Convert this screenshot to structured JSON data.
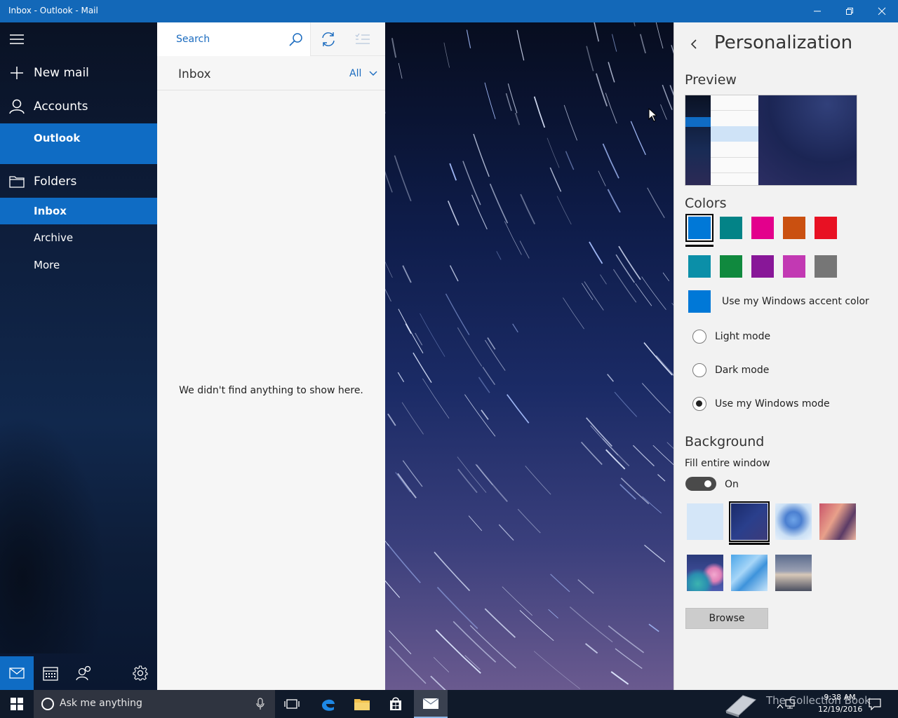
{
  "window": {
    "title": "Inbox - Outlook - Mail"
  },
  "nav": {
    "new_mail": "New mail",
    "accounts": "Accounts",
    "account_name": "Outlook",
    "folders": "Folders",
    "folder_items": [
      "Inbox",
      "Archive",
      "More"
    ]
  },
  "list": {
    "search_placeholder": "Search",
    "header": "Inbox",
    "filter": "All",
    "empty_message": "We didn't find anything to show here."
  },
  "panel": {
    "title": "Personalization",
    "preview_label": "Preview",
    "colors_label": "Colors",
    "colors": [
      "#0078d7",
      "#038387",
      "#e3008c",
      "#ca5010",
      "#e81123",
      "#0b8fa8",
      "#10893e",
      "#881798",
      "#c239b3",
      "#767676"
    ],
    "selected_color": "#0078d7",
    "accent_label": "Use my Windows accent color",
    "modes": [
      {
        "label": "Light mode",
        "selected": false
      },
      {
        "label": "Dark mode",
        "selected": false
      },
      {
        "label": "Use my Windows mode",
        "selected": true
      }
    ],
    "background_label": "Background",
    "fill_label": "Fill entire window",
    "fill_state": "On",
    "browse_label": "Browse"
  },
  "taskbar": {
    "cortana_placeholder": "Ask me anything",
    "time": "9:38 AM",
    "date": "12/19/2016",
    "watermark": "The Collection Book"
  }
}
